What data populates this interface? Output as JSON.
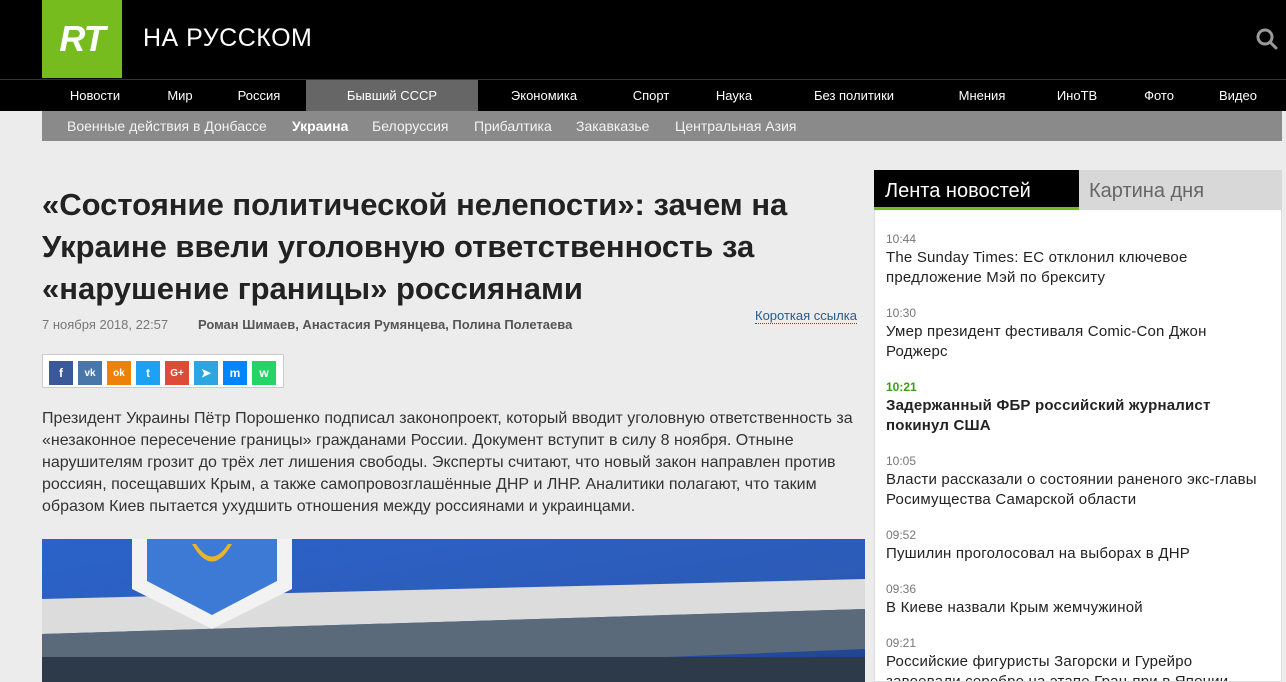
{
  "header": {
    "logo": "RT",
    "brand": "НА РУССКОМ"
  },
  "nav": {
    "items": [
      "Новости",
      "Мир",
      "Россия",
      "Бывший СССР",
      "Экономика",
      "Спорт",
      "Наука",
      "Без политики",
      "Мнения",
      "ИноТВ",
      "Фото",
      "Видео"
    ],
    "active": "Бывший СССР"
  },
  "subnav": {
    "items": [
      "Военные действия в Донбассе",
      "Украина",
      "Белоруссия",
      "Прибалтика",
      "Закавказье",
      "Центральная Азия"
    ],
    "active": "Украина"
  },
  "article": {
    "title": "«Состояние политической нелепости»: зачем на Украине ввели уголовную ответственность за «нарушение границы» россиянами",
    "date": "7 ноября 2018, 22:57",
    "authors": "Роман Шимаев, Анастасия Румянцева, Полина Полетаева",
    "short_link": "Короткая ссылка",
    "lead": "Президент Украины Пётр Порошенко подписал законопроект, который вводит уголовную ответственность за «незаконное пересечение границы» гражданами России. Документ вступит в силу 8 ноября. Отныне нарушителям грозит до трёх лет лишения свободы. Эксперты считают, что новый закон направлен против россиян, посещавших Крым, а также самопровозглашённые ДНР и ЛНР. Аналитики полагают, что таким образом Киев пытается ухудшить отношения между россиянами и украинцами."
  },
  "share": [
    {
      "name": "facebook-icon",
      "glyph": "f",
      "color": "#3b5998"
    },
    {
      "name": "vk-icon",
      "glyph": "vk",
      "color": "#4a76a8"
    },
    {
      "name": "odnoklassniki-icon",
      "glyph": "ok",
      "color": "#ee8208"
    },
    {
      "name": "twitter-icon",
      "glyph": "t",
      "color": "#1da1f2"
    },
    {
      "name": "googleplus-icon",
      "glyph": "G+",
      "color": "#dd4b39"
    },
    {
      "name": "telegram-icon",
      "glyph": "➤",
      "color": "#2ca5e0"
    },
    {
      "name": "messenger-icon",
      "glyph": "m",
      "color": "#0084ff"
    },
    {
      "name": "whatsapp-icon",
      "glyph": "w",
      "color": "#25d366"
    }
  ],
  "sidebar": {
    "tab_live": "Лента новостей",
    "tab_day": "Картина дня",
    "feed": [
      {
        "time": "10:44",
        "title": "The Sunday Times: ЕС отклонил ключевое предложение Мэй по брекситу"
      },
      {
        "time": "10:30",
        "title": "Умер президент фестиваля Comic-Con Джон Роджерс"
      },
      {
        "time": "10:21",
        "title": "Задержанный ФБР российский журналист покинул США",
        "highlight": true
      },
      {
        "time": "10:05",
        "title": "Власти рассказали о состоянии раненого экс-главы Росимущества Самарской области"
      },
      {
        "time": "09:52",
        "title": "Пушилин проголосовал на выборах в ДНР"
      },
      {
        "time": "09:36",
        "title": "В Киеве назвали Крым жемчужиной"
      },
      {
        "time": "09:21",
        "title": "Российские фигуристы Загорски и Гурейро завоевали серебро на этапе Гран-при в Японии"
      }
    ]
  },
  "colors": {
    "brand_green": "#77bc1f",
    "active_nav": "#666666",
    "subnav": "#8a8a8a"
  }
}
